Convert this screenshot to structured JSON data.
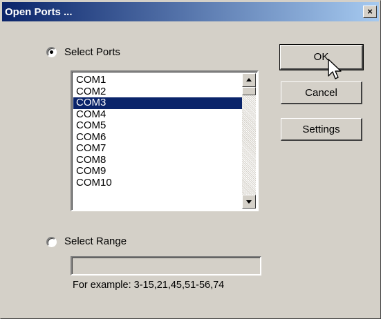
{
  "window": {
    "title": "Open Ports ...",
    "close_glyph": "×"
  },
  "select_ports": {
    "label": "Select Ports",
    "checked": true
  },
  "ports_list": {
    "items": [
      "COM1",
      "COM2",
      "COM3",
      "COM4",
      "COM5",
      "COM6",
      "COM7",
      "COM8",
      "COM9",
      "COM10"
    ],
    "selected": "COM3"
  },
  "select_range": {
    "label": "Select Range",
    "checked": false,
    "input_value": "",
    "hint": "For example: 3-15,21,45,51-56,74"
  },
  "buttons": {
    "ok": "OK",
    "cancel": "Cancel",
    "settings": "Settings"
  },
  "colors": {
    "face": "#d4d0c8",
    "title_start": "#0a246a",
    "title_end": "#a6caf0",
    "selection": "#0a246a"
  }
}
